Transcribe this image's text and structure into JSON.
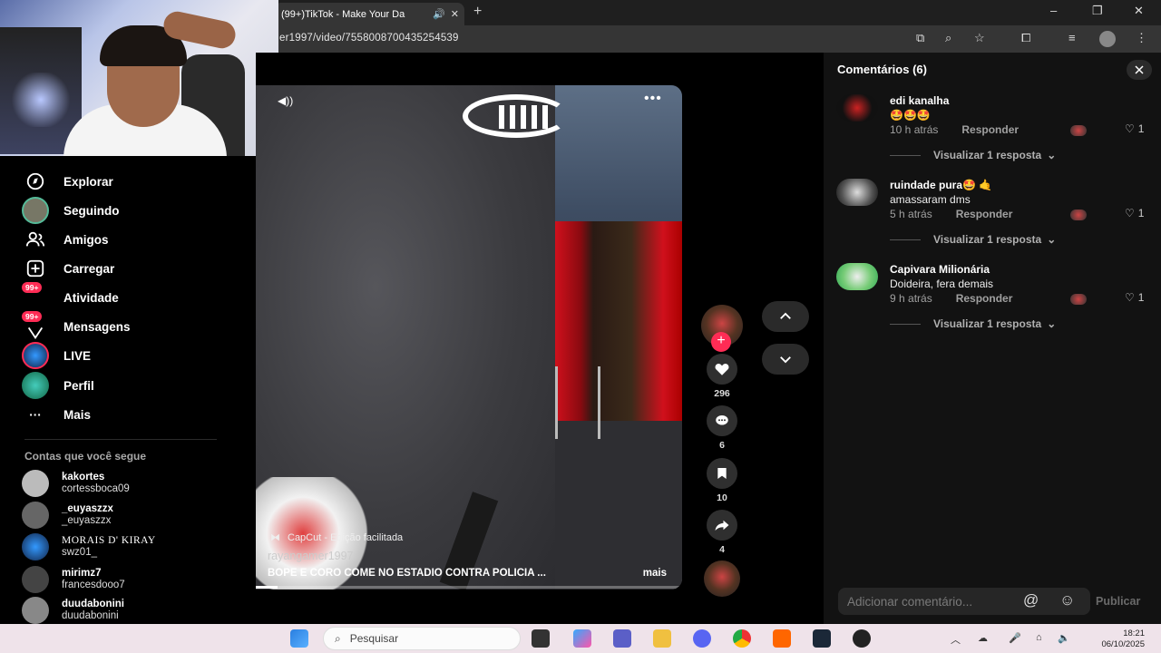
{
  "browser": {
    "tab_title": "(99+)TikTok - Make Your Da",
    "url": "er1997/video/7558008700435254539",
    "new_tab": "+",
    "win_min": "–",
    "win_max": "❐",
    "win_close": "✕"
  },
  "sidebar": {
    "items": [
      {
        "label": "Explorar",
        "icon": "compass-icon"
      },
      {
        "label": "Seguindo",
        "icon": "following-avatar-icon"
      },
      {
        "label": "Amigos",
        "icon": "friends-icon"
      },
      {
        "label": "Carregar",
        "icon": "upload-icon"
      },
      {
        "label": "Atividade",
        "icon": "activity-icon",
        "badge": "99+"
      },
      {
        "label": "Mensagens",
        "icon": "messages-icon",
        "badge": "99+"
      },
      {
        "label": "LIVE",
        "icon": "live-icon"
      },
      {
        "label": "Perfil",
        "icon": "profile-icon"
      },
      {
        "label": "Mais",
        "icon": "more-icon",
        "glyph": "···"
      }
    ],
    "following_heading": "Contas que você segue",
    "following": [
      {
        "name": "kakortes",
        "username": "cortessboca09"
      },
      {
        "name": "_euyaszzx",
        "username": "_euyaszzx"
      },
      {
        "name": "MORAIS D' KIRAY",
        "username": "swz01_"
      },
      {
        "name": "mirimz7",
        "username": "francesdooo7"
      },
      {
        "name": "duudabonini",
        "username": "duudabonini"
      }
    ]
  },
  "video": {
    "capcut_label": "CapCut - Edição facilitada",
    "author": "rayangamer1997",
    "description": "BOPE E CORO COME NO ESTADIO CONTRA POLICIA ...",
    "more_label": "mais",
    "progress": 0.05
  },
  "actions": {
    "likes": "296",
    "comments": "6",
    "saves": "10",
    "shares": "4",
    "follow_plus": "+"
  },
  "comments_panel": {
    "title": "Comentários (6)",
    "comments": [
      {
        "user": "edi kanalha",
        "text": "🤩🤩🤩",
        "time": "10 h atrás",
        "reply": "Responder",
        "likes": "1",
        "view_replies": "Visualizar 1 resposta"
      },
      {
        "user": "ruindade pura🤩 🤙",
        "text": "amassaram dms",
        "time": "5 h atrás",
        "reply": "Responder",
        "likes": "1",
        "view_replies": "Visualizar 1 resposta"
      },
      {
        "user": "Capivara Milionária",
        "text": "Doideira, fera demais",
        "time": "9 h atrás",
        "reply": "Responder",
        "likes": "1",
        "view_replies": "Visualizar 1 resposta"
      }
    ],
    "input_placeholder": "Adicionar comentário...",
    "publish_label": "Publicar"
  },
  "taskbar": {
    "search_placeholder": "Pesquisar",
    "time": "18:21",
    "date": "06/10/2025"
  },
  "colors": {
    "accent": "#fe2c55",
    "panel_bg": "#121212",
    "taskbar_bg": "#efe3ea"
  }
}
